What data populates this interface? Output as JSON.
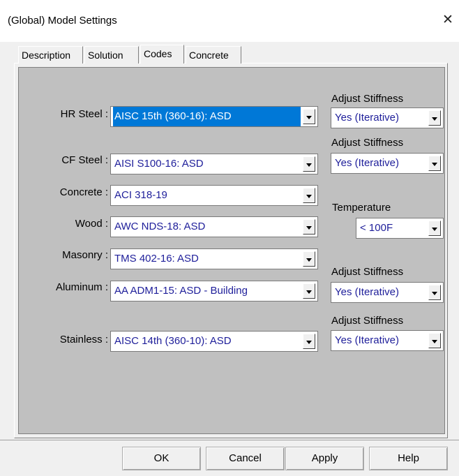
{
  "window": {
    "title": "(Global) Model Settings",
    "close_glyph": "✕"
  },
  "tabs": [
    {
      "label": "Description"
    },
    {
      "label": "Solution"
    },
    {
      "label": "Codes"
    },
    {
      "label": "Concrete"
    }
  ],
  "codes": [
    {
      "label": "HR Steel :",
      "value": "AISC 15th (360-16): ASD"
    },
    {
      "label": "CF Steel :",
      "value": "AISI S100-16: ASD"
    },
    {
      "label": "Concrete :",
      "value": "ACI 318-19"
    },
    {
      "label": "Wood :",
      "value": "AWC NDS-18: ASD"
    },
    {
      "label": "Masonry :",
      "value": "TMS 402-16: ASD"
    },
    {
      "label": "Aluminum :",
      "value": "AA ADM1-15: ASD - Building"
    },
    {
      "label": "Stainless :",
      "value": "AISC 14th (360-10): ASD"
    }
  ],
  "side": {
    "hr_steel": {
      "label": "Adjust Stiffness",
      "value": "Yes (Iterative)"
    },
    "cf_steel": {
      "label": "Adjust Stiffness",
      "value": "Yes (Iterative)"
    },
    "wood_temp": {
      "label": "Temperature",
      "value": "< 100F"
    },
    "aluminum": {
      "label": "Adjust Stiffness",
      "value": "Yes (Iterative)"
    },
    "stainless": {
      "label": "Adjust Stiffness",
      "value": "Yes (Iterative)"
    }
  },
  "buttons": {
    "ok": "OK",
    "cancel": "Cancel",
    "apply": "Apply",
    "help": "Help"
  }
}
